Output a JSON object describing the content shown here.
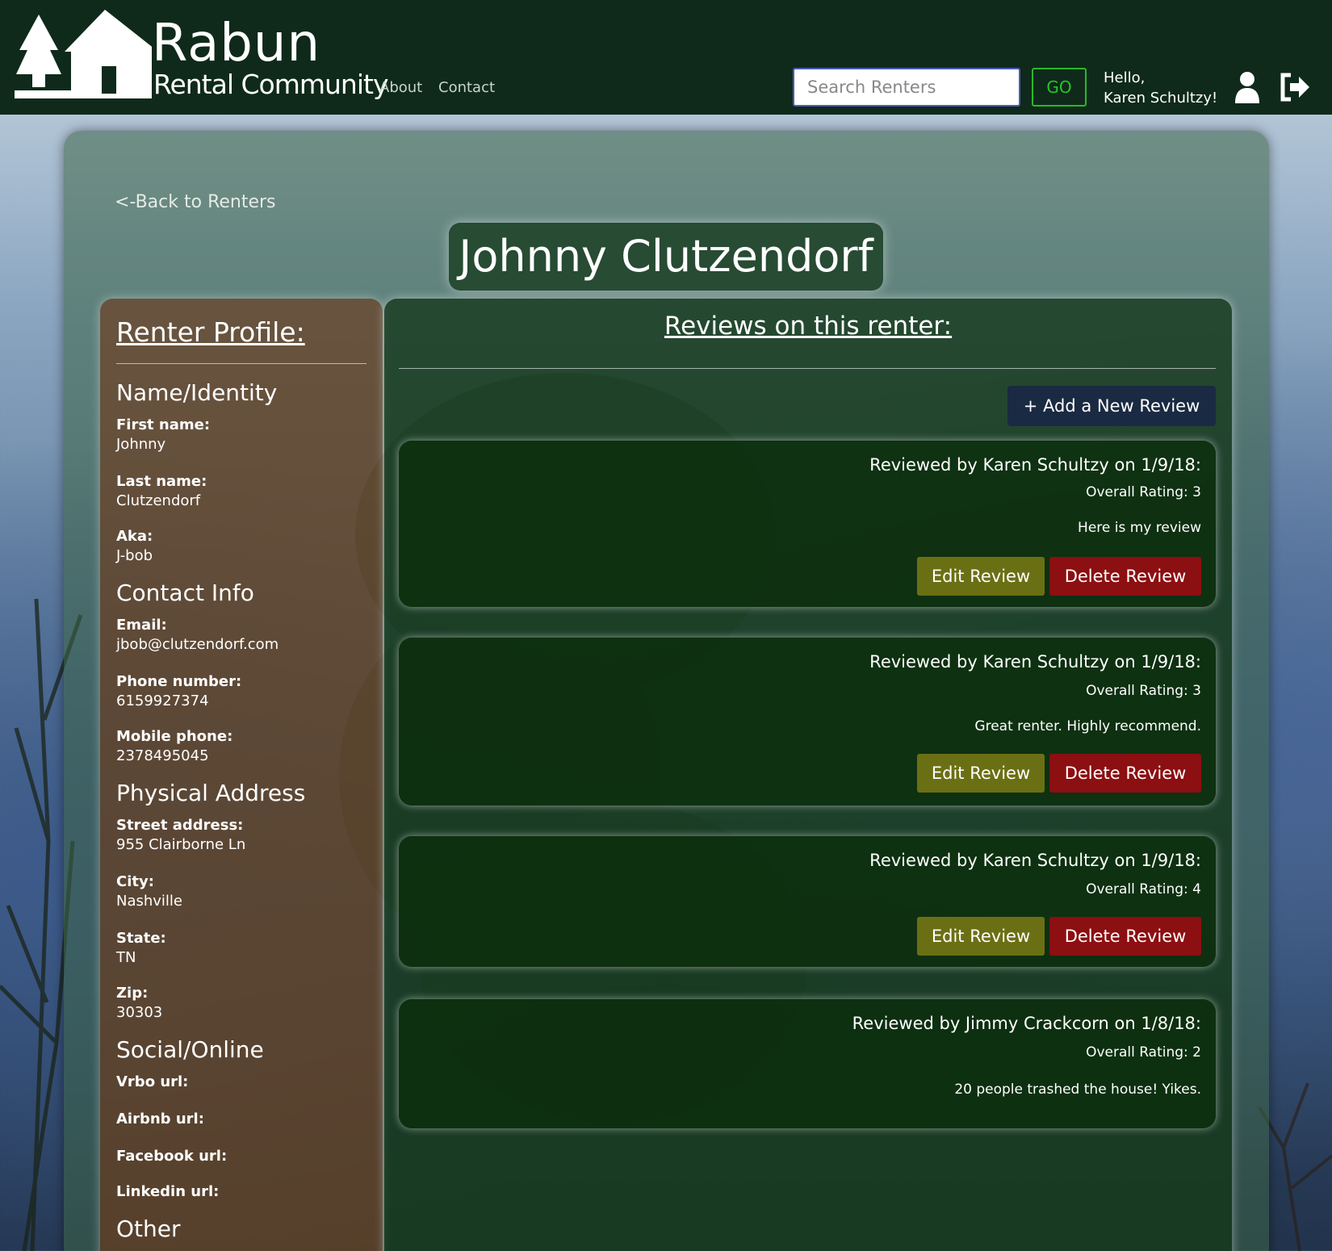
{
  "header": {
    "brand_main": "Rabun",
    "brand_sub": "Rental Community",
    "nav": [
      "About",
      "Contact"
    ],
    "search_placeholder": "Search Renters",
    "go_label": "GO",
    "greeting_line1": "Hello,",
    "greeting_line2": "Karen Schultzy!",
    "user_icon": "user-icon",
    "logout_icon": "sign-out-icon"
  },
  "page": {
    "back_link": "<-Back to Renters",
    "renter_name": "Johnny Clutzendorf"
  },
  "profile": {
    "heading": "Renter Profile:",
    "sections": {
      "name_identity": "Name/Identity",
      "contact_info": "Contact Info",
      "physical_address": "Physical Address",
      "social_online": "Social/Online",
      "other": "Other"
    },
    "fields": {
      "first_name": {
        "label": "First name:",
        "value": "Johnny"
      },
      "last_name": {
        "label": "Last name:",
        "value": "Clutzendorf"
      },
      "aka": {
        "label": "Aka:",
        "value": "J-bob"
      },
      "email": {
        "label": "Email:",
        "value": "jbob@clutzendorf.com"
      },
      "phone": {
        "label": "Phone number:",
        "value": "6159927374"
      },
      "mobile": {
        "label": "Mobile phone:",
        "value": "2378495045"
      },
      "street": {
        "label": "Street address:",
        "value": "955 Clairborne Ln"
      },
      "city": {
        "label": "City:",
        "value": "Nashville"
      },
      "state": {
        "label": "State:",
        "value": "TN"
      },
      "zip": {
        "label": "Zip:",
        "value": "30303"
      },
      "vrbo": {
        "label": "Vrbo url:",
        "value": ""
      },
      "airbnb": {
        "label": "Airbnb url:",
        "value": ""
      },
      "facebook": {
        "label": "Facebook url:",
        "value": ""
      },
      "linkedin": {
        "label": "Linkedin url:",
        "value": ""
      }
    }
  },
  "reviews": {
    "heading": "Reviews on this renter:",
    "add_label": "+ Add a New Review",
    "edit_label": "Edit Review",
    "delete_label": "Delete Review",
    "items": [
      {
        "by": "Reviewed by Karen Schultzy on 1/9/18:",
        "rating": "Overall Rating: 3",
        "text": "Here is my review"
      },
      {
        "by": "Reviewed by Karen Schultzy on 1/9/18:",
        "rating": "Overall Rating: 3",
        "text": "Great renter. Highly recommend."
      },
      {
        "by": "Reviewed by Karen Schultzy on 1/9/18:",
        "rating": "Overall Rating: 4",
        "text": ""
      },
      {
        "by": "Reviewed by Jimmy Crackcorn on 1/8/18:",
        "rating": "Overall Rating: 2",
        "text": "20 people trashed the house! Yikes."
      }
    ]
  },
  "colors": {
    "header_bg": "#0f2a1a",
    "go_green": "#2bc22b",
    "edit_olive": "#6b6f14",
    "delete_red": "#8c0f12",
    "add_navy": "#1a2a42",
    "profile_brown": "#6e3719"
  }
}
